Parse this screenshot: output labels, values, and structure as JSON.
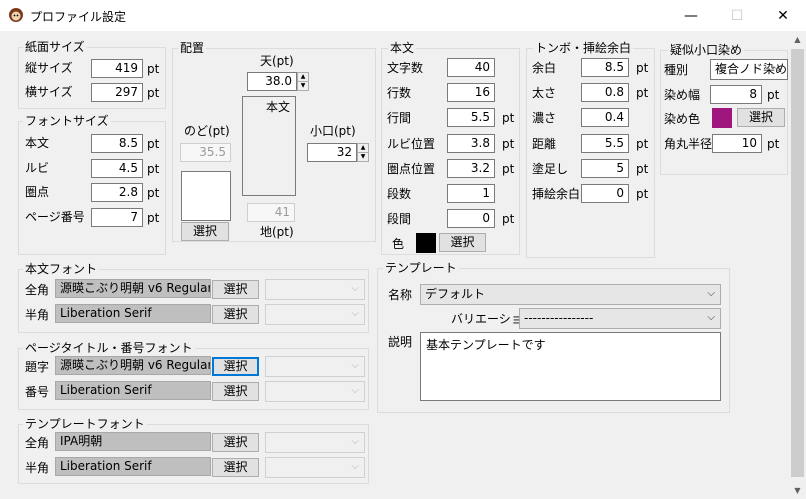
{
  "window": {
    "title": "プロファイル設定",
    "minimize": "—",
    "maximize": "☐",
    "close": "✕"
  },
  "paper": {
    "label": "紙面サイズ",
    "height_label": "縦サイズ",
    "height": "419",
    "width_label": "横サイズ",
    "width": "297",
    "unit": "pt"
  },
  "fontsize": {
    "label": "フォントサイズ",
    "body_label": "本文",
    "body": "8.5",
    "ruby_label": "ルビ",
    "ruby": "4.5",
    "dot_label": "圏点",
    "dot": "2.8",
    "page_label": "ページ番号",
    "page": "7",
    "unit": "pt"
  },
  "layout": {
    "label": "配置",
    "top_label": "天(pt)",
    "top": "38.0",
    "gutter_label": "のど(pt)",
    "gutter": "35.5",
    "fore_label": "小口(pt)",
    "fore": "32",
    "bottom_label": "地(pt)",
    "bottom": "41",
    "body_label": "本文",
    "select": "選択"
  },
  "body": {
    "label": "本文",
    "chars_label": "文字数",
    "chars": "40",
    "lines_label": "行数",
    "lines": "16",
    "linespace_label": "行間",
    "linespace": "5.5",
    "rubypos_label": "ルビ位置",
    "rubypos": "3.8",
    "dotpos_label": "圏点位置",
    "dotpos": "3.2",
    "cols_label": "段数",
    "cols": "1",
    "colspace_label": "段間",
    "colspace": "0",
    "color_label": "色",
    "color": "#000000",
    "select": "選択",
    "unit": "pt"
  },
  "tombo": {
    "label": "トンボ・挿絵余白",
    "margin_label": "余白",
    "margin": "8.5",
    "thick_label": "太さ",
    "thick": "0.8",
    "dark_label": "濃さ",
    "dark": "0.4",
    "dist_label": "距離",
    "dist": "5.5",
    "bleed_label": "塗足し",
    "bleed": "5",
    "illust_label": "挿絵余白",
    "illust": "0",
    "unit": "pt"
  },
  "edge": {
    "label": "疑似小口染め",
    "type_label": "種別",
    "type": "複合ノド染め",
    "width_label": "染め幅",
    "width": "8",
    "color_label": "染め色",
    "color": "#a0167f",
    "select": "選択",
    "radius_label": "角丸半径",
    "radius": "10",
    "unit": "pt"
  },
  "bodyfont": {
    "label": "本文フォント",
    "full_label": "全角",
    "full": "源暎こぶり明朝 v6 Regular",
    "half_label": "半角",
    "half": "Liberation Serif",
    "select": "選択"
  },
  "pagefont": {
    "label": "ページタイトル・番号フォント",
    "title_label": "題字",
    "title": "源暎こぶり明朝 v6 Regular",
    "num_label": "番号",
    "num": "Liberation Serif",
    "select": "選択"
  },
  "tplfont": {
    "label": "テンプレートフォント",
    "full_label": "全角",
    "full": "IPA明朝",
    "half_label": "半角",
    "half": "Liberation Serif",
    "select": "選択"
  },
  "template": {
    "label": "テンプレート",
    "name_label": "名称",
    "name": "デフォルト",
    "variation_label": "バリエーション",
    "variation": "----------------",
    "desc_label": "説明",
    "desc": "基本テンプレートです"
  }
}
